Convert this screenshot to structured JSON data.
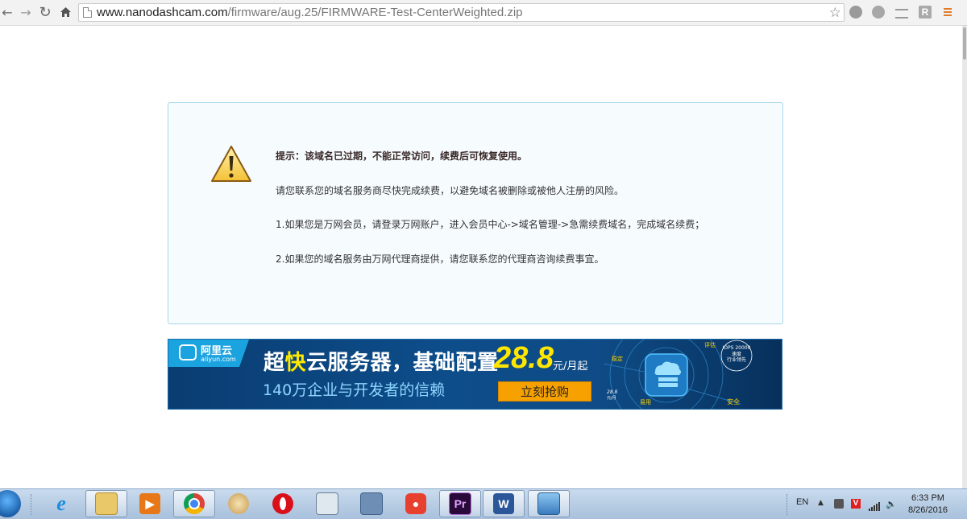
{
  "browser": {
    "url_host": "www.nanodashcam.com",
    "url_path": "/firmware/aug.25/FIRMWARE-Test-CenterWeighted.zip",
    "ext_r_label": "R"
  },
  "notice": {
    "title": "提示：该域名已过期，不能正常访问，续费后可恢复使用。",
    "line1": "请您联系您的域名服务商尽快完成续费，以避免域名被删除或被他人注册的风险。",
    "line2": "1.如果您是万网会员，请登录万网账户，进入会员中心->域名管理->急需续费域名，完成域名续费；",
    "line3": "2.如果您的域名服务由万网代理商提供，请您联系您的代理商咨询续费事宜。"
  },
  "banner": {
    "logo_name": "阿里云",
    "logo_domain": "aliyun.com",
    "headline_pre": "超",
    "headline_hl": "快",
    "headline_post": "云服务器，基础配置",
    "price": "28.8",
    "unit": "元/月起",
    "subline": "140万企业与开发者的信赖",
    "button": "立刻抢购",
    "graphic_labels": [
      "评估",
      "稳定",
      "IOPS 20000",
      "速度",
      "行业领先",
      "28.8",
      "元/月",
      "易用",
      "安全"
    ]
  },
  "taskbar": {
    "lang": "EN",
    "time": "6:33 PM",
    "date": "8/26/2016"
  },
  "colors": {
    "notice_border": "#a8d8ea",
    "notice_bg": "#f6fbfe",
    "banner_bg": "#0d4d8a",
    "price": "#ffe600",
    "button": "#f6a100"
  }
}
